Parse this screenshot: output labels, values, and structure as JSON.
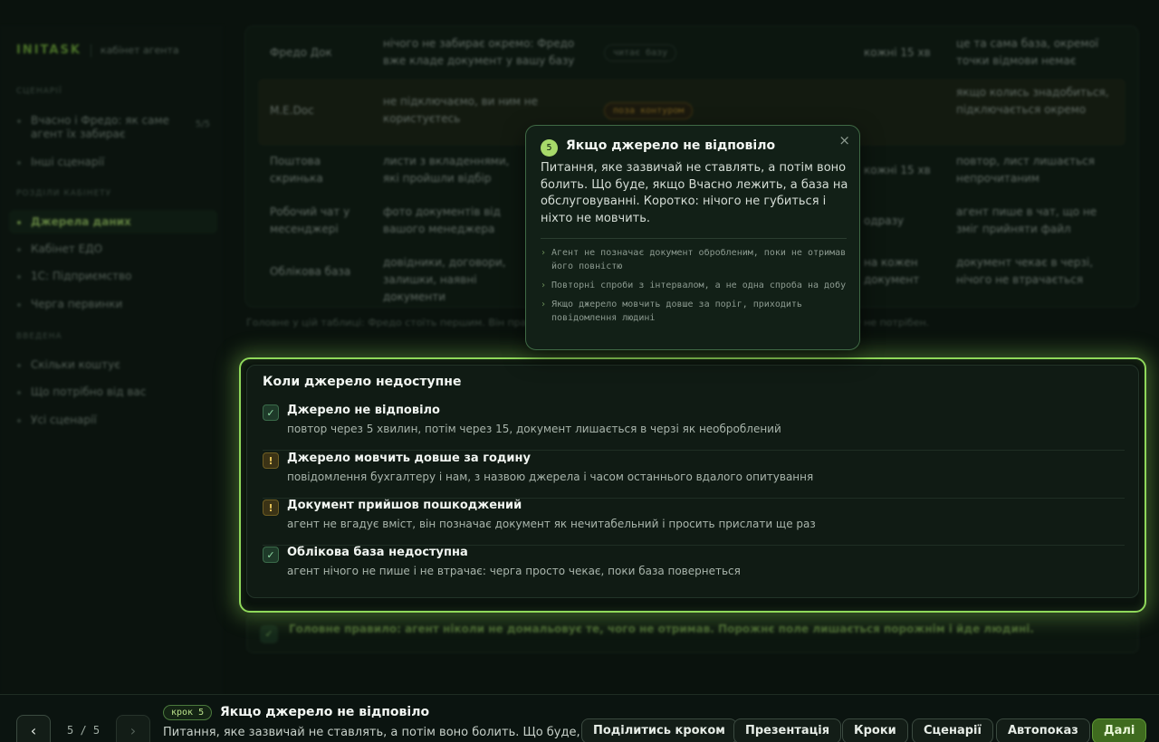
{
  "app": {
    "brand": "INITASK",
    "subtitle": "кабінет агента"
  },
  "sidebar": {
    "section_scenarios": "СЦЕНАРІЇ",
    "scenario_item": {
      "label": "Вчасно і Фредо: як саме агент їх забирає",
      "count": "5/5"
    },
    "scenario_item2": "Інші сценарії",
    "section_cabinet": "РОЗДІЛИ КАБІНЕТУ",
    "cabinet_items": [
      "Джерела даних",
      "Кабінет ЕДО",
      "1С: Підприємство",
      "Черга первинки"
    ],
    "section_intro": "ВВЕДЕНА",
    "intro_items": [
      "Скільки коштує",
      "Що потрібно від вас",
      "Усі сценарії"
    ]
  },
  "table": {
    "rows": [
      {
        "name": "Фредо Док",
        "desc": "нічого не забирає окремо: Фредо вже кладе документ у вашу базу",
        "tag": "читає базу",
        "freq": "кожні 15 хв",
        "fail": "це та сама база, окремої точки відмови немає"
      },
      {
        "name": "M.E.Doc",
        "desc": "не підключаємо, ви ним не користуєтесь",
        "tag": "поза контуром",
        "freq": "",
        "fail": "якщо колись знадобиться, підключається окремо"
      },
      {
        "name": "Поштова скринька",
        "desc": "листи з вкладеннями, які пройшли відбір",
        "tag": "",
        "freq": "кожні 15 хв",
        "fail": "повтор, лист лишається непрочитаним"
      },
      {
        "name": "Робочий чат у месенджері",
        "desc": "фото документів від вашого менеджера",
        "tag": "",
        "freq": "одразу",
        "fail": "агент пише в чат, що не зміг прийняти файл"
      },
      {
        "name": "Облікова база",
        "desc": "довідники, договори, залишки, наявні документи",
        "tag": "",
        "freq": "на кожен документ",
        "fail": "документ чекає в черзі, нічого не втрачається"
      }
    ],
    "note": "Головне у цій таблиці: Фредо стоїть першим. Він пра… агент бачить одразу в базі, і окремий доступ до Фредо йому не потрібен."
  },
  "focus": {
    "title": "Коли джерело недоступне",
    "items": [
      {
        "head": "Джерело не відповіло",
        "desc": "повтор через 5 хвилин, потім через 15, документ лишається в черзі як необроблений",
        "icon": "check",
        "mark": "✓"
      },
      {
        "head": "Джерело мовчить довше за годину",
        "desc": "повідомлення бухгалтеру і нам, з назвою джерела і часом останнього вдалого опитування",
        "icon": "warning",
        "mark": "!"
      },
      {
        "head": "Документ прийшов пошкоджений",
        "desc": "агент не вгадує вміст, він позначає документ як нечитабельний і просить прислати ще раз",
        "icon": "warning",
        "mark": "!"
      },
      {
        "head": "Облікова база недоступна",
        "desc": "агент нічого не пише і не втрачає: черга просто чекає, поки база повернеться",
        "icon": "check",
        "mark": "✓"
      }
    ]
  },
  "rule": {
    "mark": "✓",
    "text": "Головне правило: агент ніколи не домальовує те, чого не отримав. Порожнє поле лишається порожнім і йде людині."
  },
  "popover": {
    "num": "5",
    "title": "Якщо джерело не відповіло",
    "close": "×",
    "body": "Питання, яке зазвичай не ставлять, а потім воно болить. Що буде, якщо Вчасно лежить, а база на обслуговуванні. Коротко: нічого не губиться і ніхто не мовчить.",
    "list": [
      "Агент не позначає документ обробленим, поки не отримав його повністю",
      "Повторні спроби з інтервалом, а не одна спроба на добу",
      "Якщо джерело мовчить довше за поріг, приходить повідомлення людині"
    ]
  },
  "bottom": {
    "prev": "‹",
    "next": "›",
    "counter": "5 / 5",
    "step_badge": "крок 5",
    "step_title": "Якщо джерело не відповіло",
    "step_desc": "Питання, яке зазвичай не ставлять, а потім воно болить. Що буде,",
    "actions": [
      "Поділитись кроком",
      "Презентація",
      "Кроки",
      "Сценарії",
      "Автопоказ"
    ],
    "primary": "Далі"
  },
  "colors": {
    "accent": "#8fd85a",
    "warning": "#e8c65a",
    "background": "#0a120d"
  }
}
